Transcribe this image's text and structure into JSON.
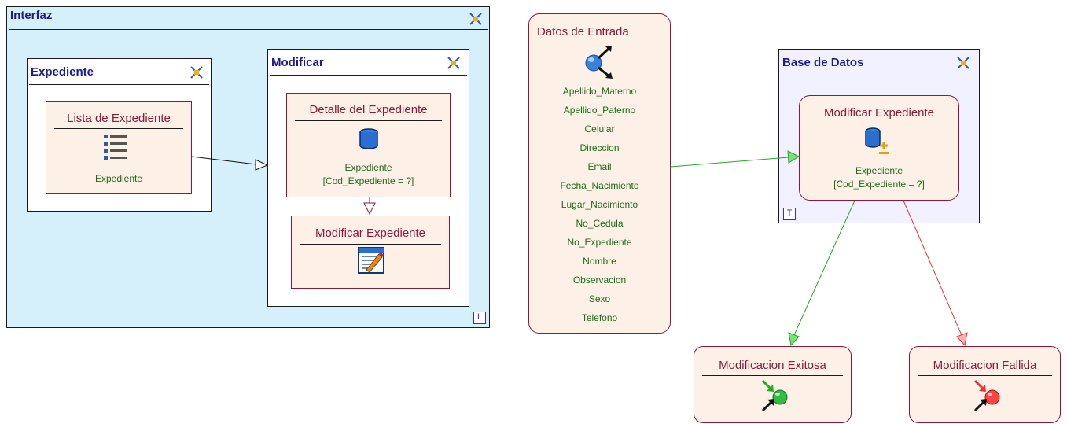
{
  "interfaz": {
    "title": "Interfaz",
    "badge": "L"
  },
  "expediente_container": {
    "title": "Expediente"
  },
  "modificar_container": {
    "title": "Modificar"
  },
  "lista_node": {
    "title": "Lista de Expediente",
    "sub": "Expediente"
  },
  "detalle_node": {
    "title": "Detalle del Expediente",
    "sub1": "Expediente",
    "sub2": "[Cod_Expediente = ?]"
  },
  "modificar_form_node": {
    "title": "Modificar Expediente"
  },
  "datos_entrada": {
    "title": "Datos de Entrada",
    "attributes": [
      "Apellido_Materno",
      "Apellido_Paterno",
      "Celular",
      "Direccion",
      "Email",
      "Fecha_Nacimiento",
      "Lugar_Nacimiento",
      "No_Cedula",
      "No_Expediente",
      "Nombre",
      "Observacion",
      "Sexo",
      "Telefono"
    ]
  },
  "base_datos": {
    "title": "Base de Datos",
    "badge": "T"
  },
  "modificar_db_node": {
    "title": "Modificar Expediente",
    "sub1": "Expediente",
    "sub2": "[Cod_Expediente = ?]"
  },
  "exito_node": {
    "title": "Modificacion Exitosa"
  },
  "fallo_node": {
    "title": "Modificacion Fallida"
  },
  "colors": {
    "interfaz_bg": "#d6f0fb",
    "base_bg": "#f1f1ff",
    "node_border": "#8b1a3a",
    "node_bg": "#fdf0e6",
    "success": "#22aa22",
    "failure": "#ee3333"
  }
}
